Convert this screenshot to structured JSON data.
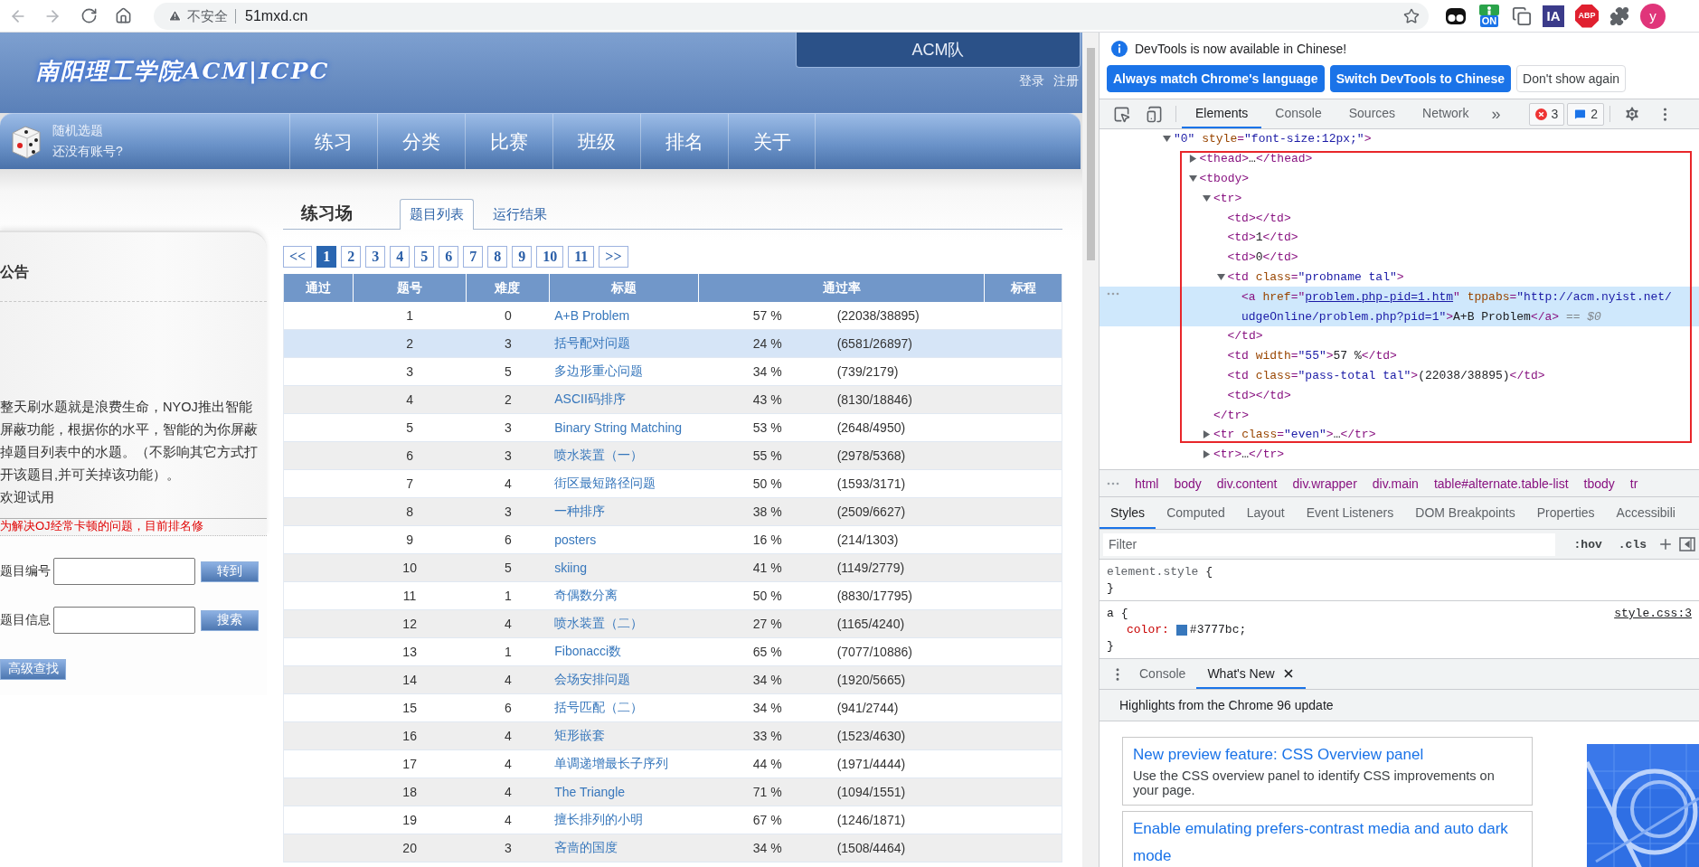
{
  "browser": {
    "security": "不安全",
    "url": "51mxd.cn",
    "extensions": [
      {
        "kind": "mask"
      },
      {
        "kind": "badge",
        "label": "ON"
      },
      {
        "kind": "pages"
      },
      {
        "kind": "square",
        "label": "IA"
      },
      {
        "kind": "octagon",
        "label": "ABP"
      },
      {
        "kind": "puzzle"
      },
      {
        "kind": "avatar",
        "label": "y"
      }
    ]
  },
  "site": {
    "logo": "南阳理工学院ACM|ICPC",
    "team": "ACM队",
    "account_links": [
      "登录",
      "注册"
    ],
    "random": {
      "title": "随机选题",
      "subtitle": "还没有账号?"
    },
    "nav": [
      "练习",
      "分类",
      "比赛",
      "班级",
      "排名",
      "关于"
    ]
  },
  "sidebar": {
    "title": "公告",
    "notice": [
      "整天刷水题就是浪费生命，NYOJ推出智能屏蔽功能，根据你的水平，智能的为你屏蔽掉题目列表中的水题。（不影响其它方式打开该题目,并可关掉该功能）。",
      "欢迎试用"
    ],
    "notice_red": "为解决OJ经常卡顿的问题，目前排名修",
    "search": [
      {
        "label": "题目编号",
        "button": "转到"
      },
      {
        "label": "题目信息",
        "button": "搜索"
      }
    ],
    "advanced": "高级查找"
  },
  "main": {
    "title": "练习场",
    "tabs": [
      {
        "label": "题目列表",
        "selected": true
      },
      {
        "label": "运行结果",
        "selected": false
      }
    ],
    "pages": [
      {
        "label": "<<",
        "selected": false
      },
      {
        "label": "1",
        "selected": true
      },
      {
        "label": "2",
        "selected": false
      },
      {
        "label": "3",
        "selected": false
      },
      {
        "label": "4",
        "selected": false
      },
      {
        "label": "5",
        "selected": false
      },
      {
        "label": "6",
        "selected": false
      },
      {
        "label": "7",
        "selected": false
      },
      {
        "label": "8",
        "selected": false
      },
      {
        "label": "9",
        "selected": false
      },
      {
        "label": "10",
        "selected": false
      },
      {
        "label": "11",
        "selected": false
      },
      {
        "label": ">>",
        "selected": false
      }
    ],
    "columns": [
      "通过",
      "题号",
      "难度",
      "标题",
      "通过率",
      "标程"
    ],
    "rows": [
      {
        "id": "1",
        "difficulty": "0",
        "title": "A+B Problem",
        "rate": "57 %",
        "count": "(22038/38895)",
        "hovered": false
      },
      {
        "id": "2",
        "difficulty": "3",
        "title": "括号配对问题",
        "rate": "24 %",
        "count": "(6581/26897)",
        "hovered": true
      },
      {
        "id": "3",
        "difficulty": "5",
        "title": "多边形重心问题",
        "rate": "34 %",
        "count": "(739/2179)",
        "hovered": false
      },
      {
        "id": "4",
        "difficulty": "2",
        "title": "ASCII码排序",
        "rate": "43 %",
        "count": "(8130/18846)",
        "hovered": false
      },
      {
        "id": "5",
        "difficulty": "3",
        "title": "Binary String Matching",
        "rate": "53 %",
        "count": "(2648/4950)",
        "hovered": false
      },
      {
        "id": "6",
        "difficulty": "3",
        "title": "喷水装置（一）",
        "rate": "55 %",
        "count": "(2978/5368)",
        "hovered": false
      },
      {
        "id": "7",
        "difficulty": "4",
        "title": "街区最短路径问题",
        "rate": "50 %",
        "count": "(1593/3171)",
        "hovered": false
      },
      {
        "id": "8",
        "difficulty": "3",
        "title": "一种排序",
        "rate": "38 %",
        "count": "(2509/6627)",
        "hovered": false
      },
      {
        "id": "9",
        "difficulty": "6",
        "title": "posters",
        "rate": "16 %",
        "count": "(214/1303)",
        "hovered": false
      },
      {
        "id": "10",
        "difficulty": "5",
        "title": "skiing",
        "rate": "41 %",
        "count": "(1149/2779)",
        "hovered": false
      },
      {
        "id": "11",
        "difficulty": "1",
        "title": "奇偶数分离",
        "rate": "50 %",
        "count": "(8830/17795)",
        "hovered": false
      },
      {
        "id": "12",
        "difficulty": "4",
        "title": "喷水装置（二）",
        "rate": "27 %",
        "count": "(1165/4240)",
        "hovered": false
      },
      {
        "id": "13",
        "difficulty": "1",
        "title": "Fibonacci数",
        "rate": "65 %",
        "count": "(7077/10886)",
        "hovered": false
      },
      {
        "id": "14",
        "difficulty": "4",
        "title": "会场安排问题",
        "rate": "34 %",
        "count": "(1920/5665)",
        "hovered": false
      },
      {
        "id": "15",
        "difficulty": "6",
        "title": "括号匹配（二）",
        "rate": "34 %",
        "count": "(941/2744)",
        "hovered": false
      },
      {
        "id": "16",
        "difficulty": "4",
        "title": "矩形嵌套",
        "rate": "33 %",
        "count": "(1523/4630)",
        "hovered": false
      },
      {
        "id": "17",
        "difficulty": "4",
        "title": "单调递增最长子序列",
        "rate": "44 %",
        "count": "(1971/4444)",
        "hovered": false
      },
      {
        "id": "18",
        "difficulty": "4",
        "title": "The Triangle",
        "rate": "71 %",
        "count": "(1094/1551)",
        "hovered": false
      },
      {
        "id": "19",
        "difficulty": "4",
        "title": "擅长排列的小明",
        "rate": "67 %",
        "count": "(1246/1871)",
        "hovered": false
      },
      {
        "id": "20",
        "difficulty": "3",
        "title": "吝啬的国度",
        "rate": "34 %",
        "count": "(1508/4464)",
        "hovered": false
      }
    ]
  },
  "devtools": {
    "notice": "DevTools is now available in Chinese!",
    "notice_buttons": [
      {
        "label": "Always match Chrome's language",
        "kind": "primary"
      },
      {
        "label": "Switch DevTools to Chinese",
        "kind": "primary"
      },
      {
        "label": "Don't show again",
        "kind": "secondary"
      }
    ],
    "tabs": [
      {
        "label": "Elements",
        "selected": true
      },
      {
        "label": "Console",
        "selected": false
      },
      {
        "label": "Sources",
        "selected": false
      },
      {
        "label": "Network",
        "selected": false
      }
    ],
    "more": "»",
    "errors": "3",
    "messages": "2",
    "dom": [
      {
        "selected": false,
        "expanded": true,
        "line": [
          {
            "kind": "val",
            "text": "\"0\""
          },
          {
            "kind": "attr",
            "text": " style"
          },
          {
            "kind": "punct",
            "text": "="
          },
          {
            "kind": "val",
            "text": "\"font-size:12px;\""
          },
          {
            "kind": "tag",
            "text": ">"
          }
        ],
        "children": [
          {
            "selected": false,
            "expanded": false,
            "line": [
              {
                "kind": "tag",
                "text": "<thead>"
              },
              {
                "kind": "text",
                "text": "…"
              },
              {
                "kind": "tag",
                "text": "</thead>"
              }
            ]
          },
          {
            "selected": false,
            "expanded": true,
            "line": [
              {
                "kind": "tag",
                "text": "<tbody>"
              }
            ],
            "children": [
              {
                "selected": false,
                "expanded": true,
                "line": [
                  {
                    "kind": "tag",
                    "text": "<tr>"
                  }
                ],
                "children": [
                  {
                    "selected": false,
                    "line": [
                      {
                        "kind": "tag",
                        "text": "<td></td>"
                      }
                    ]
                  },
                  {
                    "selected": false,
                    "line": [
                      {
                        "kind": "tag",
                        "text": "<td>"
                      },
                      {
                        "kind": "text",
                        "text": "1"
                      },
                      {
                        "kind": "tag",
                        "text": "</td>"
                      }
                    ]
                  },
                  {
                    "selected": false,
                    "line": [
                      {
                        "kind": "tag",
                        "text": "<td>"
                      },
                      {
                        "kind": "text",
                        "text": "0"
                      },
                      {
                        "kind": "tag",
                        "text": "</td>"
                      }
                    ]
                  },
                  {
                    "selected": false,
                    "expanded": true,
                    "line": [
                      {
                        "kind": "tag",
                        "text": "<td"
                      },
                      {
                        "kind": "attr",
                        "text": " class"
                      },
                      {
                        "kind": "punct",
                        "text": "="
                      },
                      {
                        "kind": "val",
                        "text": "\"probname tal\""
                      },
                      {
                        "kind": "tag",
                        "text": ">"
                      }
                    ],
                    "children": [
                      {
                        "selected": true,
                        "line": [
                          {
                            "kind": "tag",
                            "text": "<a"
                          },
                          {
                            "kind": "attr",
                            "text": " href"
                          },
                          {
                            "kind": "punct",
                            "text": "=\""
                          },
                          {
                            "kind": "link",
                            "text": "problem.php-pid=1.htm"
                          },
                          {
                            "kind": "punct",
                            "text": "\""
                          },
                          {
                            "kind": "attr",
                            "text": " tppabs"
                          },
                          {
                            "kind": "punct",
                            "text": "="
                          },
                          {
                            "kind": "val",
                            "text": "\"http://acm.nyist.net/"
                          }
                        ],
                        "wrap": [
                          {
                            "kind": "val",
                            "text": "udgeOnline/problem.php?pid=1\""
                          },
                          {
                            "kind": "tag",
                            "text": ">"
                          },
                          {
                            "kind": "text",
                            "text": "A+B Problem"
                          },
                          {
                            "kind": "tag",
                            "text": "</a>"
                          },
                          {
                            "kind": "meta",
                            "text": " == $0"
                          }
                        ]
                      }
                    ],
                    "close": [
                      {
                        "kind": "tag",
                        "text": "</td>"
                      }
                    ]
                  },
                  {
                    "selected": false,
                    "line": [
                      {
                        "kind": "tag",
                        "text": "<td"
                      },
                      {
                        "kind": "attr",
                        "text": " width"
                      },
                      {
                        "kind": "punct",
                        "text": "="
                      },
                      {
                        "kind": "val",
                        "text": "\"55\""
                      },
                      {
                        "kind": "tag",
                        "text": ">"
                      },
                      {
                        "kind": "text",
                        "text": "57 %"
                      },
                      {
                        "kind": "tag",
                        "text": "</td>"
                      }
                    ]
                  },
                  {
                    "selected": false,
                    "line": [
                      {
                        "kind": "tag",
                        "text": "<td"
                      },
                      {
                        "kind": "attr",
                        "text": " class"
                      },
                      {
                        "kind": "punct",
                        "text": "="
                      },
                      {
                        "kind": "val",
                        "text": "\"pass-total tal\""
                      },
                      {
                        "kind": "tag",
                        "text": ">"
                      },
                      {
                        "kind": "text",
                        "text": "(22038/38895)"
                      },
                      {
                        "kind": "tag",
                        "text": "</td>"
                      }
                    ]
                  },
                  {
                    "selected": false,
                    "line": [
                      {
                        "kind": "tag",
                        "text": "<td></td>"
                      }
                    ]
                  }
                ],
                "close": [
                  {
                    "kind": "tag",
                    "text": "</tr>"
                  }
                ]
              },
              {
                "selected": false,
                "expanded": false,
                "line": [
                  {
                    "kind": "tag",
                    "text": "<tr"
                  },
                  {
                    "kind": "attr",
                    "text": " class"
                  },
                  {
                    "kind": "punct",
                    "text": "="
                  },
                  {
                    "kind": "val",
                    "text": "\"even\""
                  },
                  {
                    "kind": "tag",
                    "text": ">"
                  },
                  {
                    "kind": "text",
                    "text": "…"
                  },
                  {
                    "kind": "tag",
                    "text": "</tr>"
                  }
                ]
              },
              {
                "selected": false,
                "expanded": false,
                "line": [
                  {
                    "kind": "tag",
                    "text": "<tr>"
                  },
                  {
                    "kind": "text",
                    "text": "…"
                  },
                  {
                    "kind": "tag",
                    "text": "</tr>"
                  }
                ]
              }
            ]
          }
        ]
      }
    ],
    "breadcrumbs": [
      "html",
      "body",
      "div.content",
      "div.wrapper",
      "div.main",
      "table#alternate.table-list",
      "tbody",
      "tr"
    ],
    "style_tabs": [
      {
        "label": "Styles",
        "selected": true
      },
      {
        "label": "Computed",
        "selected": false
      },
      {
        "label": "Layout",
        "selected": false
      },
      {
        "label": "Event Listeners",
        "selected": false
      },
      {
        "label": "DOM Breakpoints",
        "selected": false
      },
      {
        "label": "Properties",
        "selected": false
      },
      {
        "label": "Accessibili",
        "selected": false
      }
    ],
    "filter_placeholder": "Filter",
    "style_buttons": [
      ":hov",
      ".cls"
    ],
    "rules": [
      {
        "kind": "inline",
        "selector": "element.style",
        "open": "{",
        "close": "}"
      },
      {
        "kind": "rule",
        "selector": "a",
        "open": "{",
        "close": "}",
        "source": "style.css:3",
        "declarations": [
          {
            "property": "color",
            "separator": ":",
            "value": "#3777bc;",
            "color": "#3777bc"
          }
        ]
      }
    ],
    "drawer_tabs": [
      {
        "label": "Console",
        "selected": false,
        "closable": false
      },
      {
        "label": "What's New",
        "selected": true,
        "closable": true
      }
    ],
    "whats_new": {
      "heading": "Highlights from the Chrome 96 update",
      "cards": [
        {
          "title": "New preview feature: CSS Overview panel",
          "description": "Use the CSS overview panel to identify CSS improvements on your page."
        },
        {
          "title": "Enable emulating prefers-contrast media and auto dark mode"
        }
      ]
    }
  }
}
